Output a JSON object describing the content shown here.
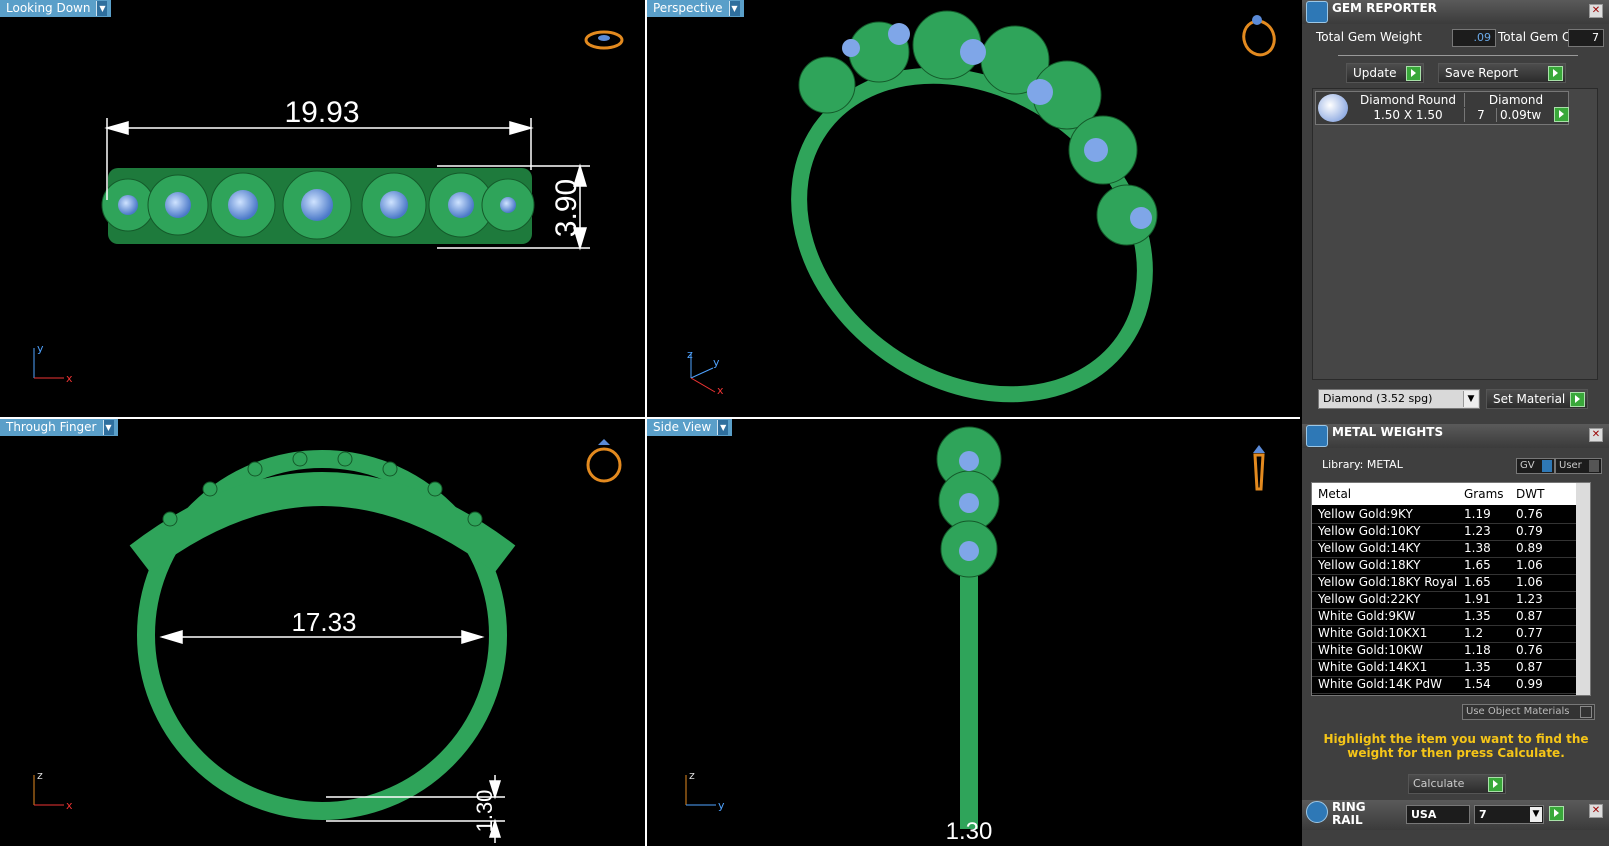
{
  "viewports": {
    "looking_down": {
      "label": "Looking Down",
      "dim_width": "19.93",
      "dim_height": "3.90",
      "axis_a": "y",
      "axis_b": "x"
    },
    "perspective": {
      "label": "Perspective",
      "axis_a": "z",
      "axis_b": "y",
      "axis_c": "x"
    },
    "through_finger": {
      "label": "Through Finger",
      "dim_diameter": "17.33",
      "dim_thickness": "1.30",
      "axis_a": "z",
      "axis_b": "x"
    },
    "side_view": {
      "label": "Side View",
      "dim_thickness": "1.30",
      "axis_a": "z",
      "axis_b": "y"
    }
  },
  "gem_reporter": {
    "title": "GEM REPORTER",
    "total_weight_label": "Total Gem Weight",
    "total_weight_value": ".09",
    "total_count_label": "Total Gem Count",
    "total_count_value": "7",
    "update_label": "Update",
    "save_report_label": "Save Report",
    "gem_row": {
      "shape": "Diamond Round",
      "size": "1.50 X 1.50",
      "type": "Diamond",
      "count": "7",
      "weight": "0.09tw"
    },
    "material_select": "Diamond    (3.52 spg)",
    "set_material_label": "Set Material"
  },
  "metal_weights": {
    "title": "METAL WEIGHTS",
    "library_label": "Library: METAL",
    "gv_label": "GV",
    "user_label": "User",
    "columns": [
      "Metal",
      "Grams",
      "DWT"
    ],
    "rows": [
      [
        "Yellow Gold:9KY",
        "1.19",
        "0.76"
      ],
      [
        "Yellow Gold:10KY",
        "1.23",
        "0.79"
      ],
      [
        "Yellow Gold:14KY",
        "1.38",
        "0.89"
      ],
      [
        "Yellow Gold:18KY",
        "1.65",
        "1.06"
      ],
      [
        "Yellow Gold:18KY Royal",
        "1.65",
        "1.06"
      ],
      [
        "Yellow Gold:22KY",
        "1.91",
        "1.23"
      ],
      [
        "White Gold:9KW",
        "1.35",
        "0.87"
      ],
      [
        "White Gold:10KX1",
        "1.2",
        "0.77"
      ],
      [
        "White Gold:10KW",
        "1.18",
        "0.76"
      ],
      [
        "White Gold:14KX1",
        "1.35",
        "0.87"
      ],
      [
        "White Gold:14K PdW",
        "1.54",
        "0.99"
      ]
    ],
    "use_object_materials_label": "Use Object Materials",
    "info_text": "Highlight the item you want to find the weight for then press Calculate.",
    "calculate_label": "Calculate"
  },
  "ring_rail": {
    "title": "RING RAIL",
    "region": "USA",
    "size": "7"
  },
  "colors": {
    "ring_green": "#2fa45a",
    "accent_blue": "#5a9fc9"
  }
}
